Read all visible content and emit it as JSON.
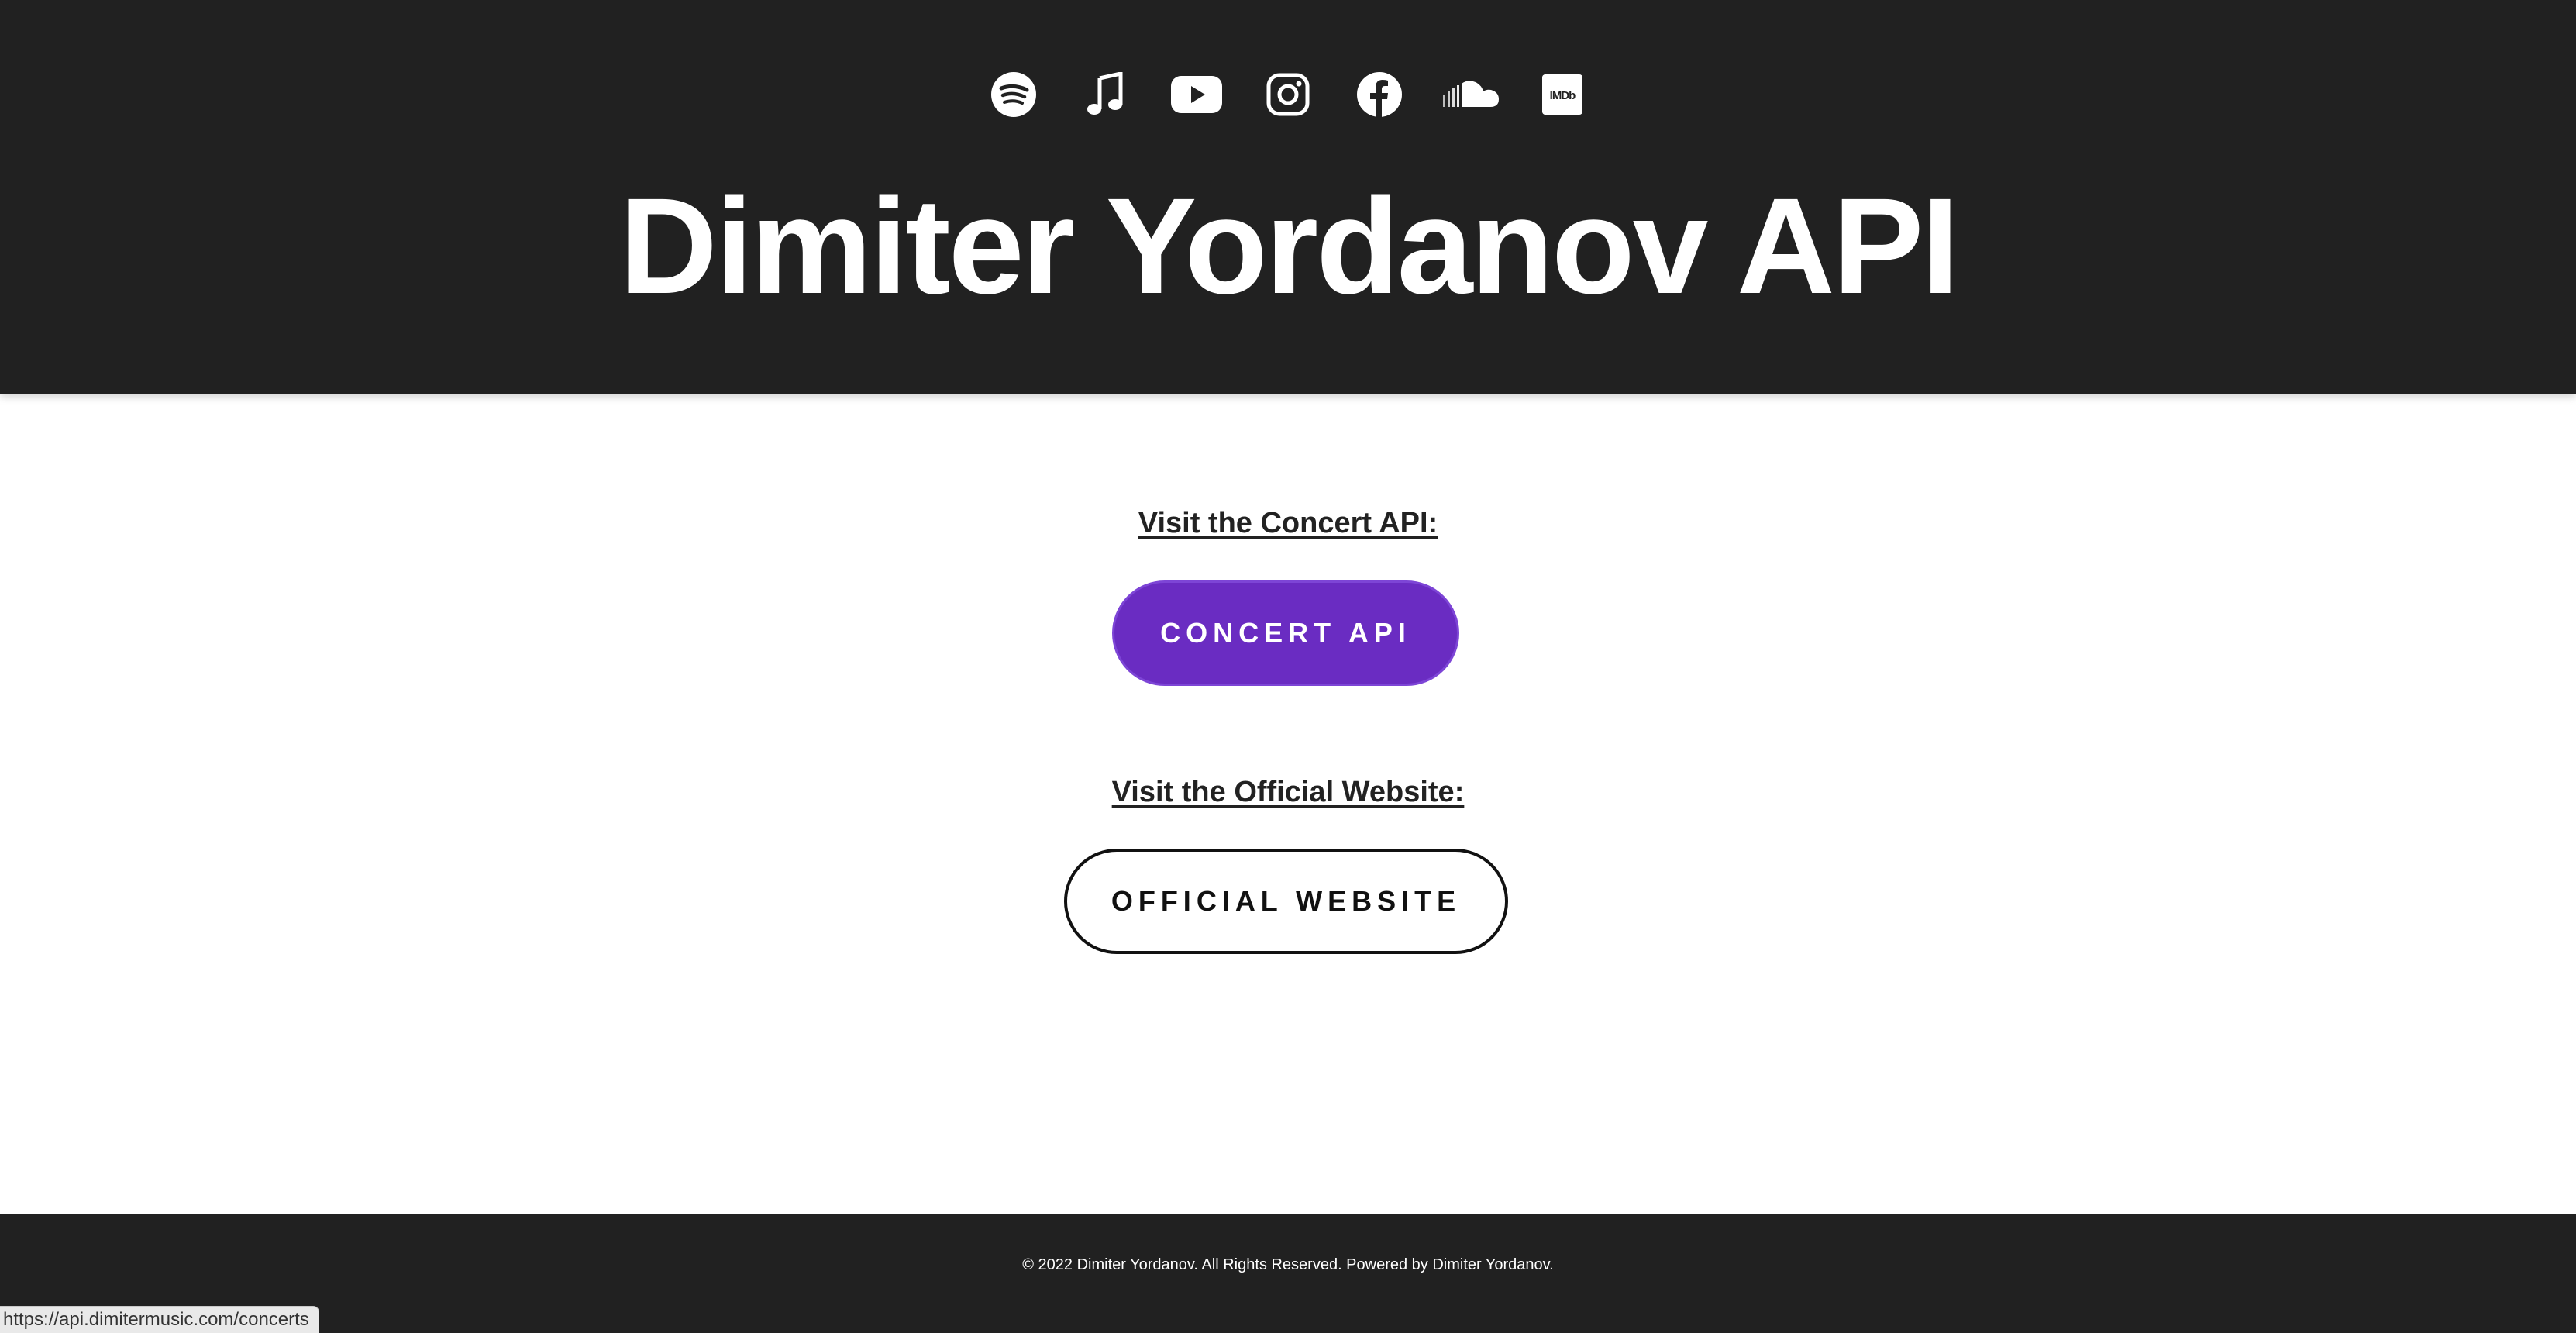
{
  "header": {
    "title": "Dimiter Yordanov API",
    "social_links": [
      {
        "name": "spotify",
        "icon": "spotify-icon"
      },
      {
        "name": "apple-music",
        "icon": "music-note-icon"
      },
      {
        "name": "youtube",
        "icon": "youtube-icon"
      },
      {
        "name": "instagram",
        "icon": "instagram-icon"
      },
      {
        "name": "facebook",
        "icon": "facebook-icon"
      },
      {
        "name": "soundcloud",
        "icon": "soundcloud-icon"
      },
      {
        "name": "imdb",
        "icon": "imdb-icon",
        "text": "IMDb"
      }
    ]
  },
  "main": {
    "concert_heading": "Visit the Concert API:",
    "concert_button": "CONCERT API",
    "website_heading": "Visit the Official Website:",
    "website_button": "OFFICIAL WEBSITE"
  },
  "footer": {
    "text": "© 2022 Dimiter Yordanov. All Rights Reserved. Powered by Dimiter Yordanov."
  },
  "status_bar": {
    "url": "https://api.dimitermusic.com/concerts"
  },
  "colors": {
    "header_bg": "#212121",
    "accent_purple": "#6a2cc2",
    "text_dark": "#222222"
  }
}
